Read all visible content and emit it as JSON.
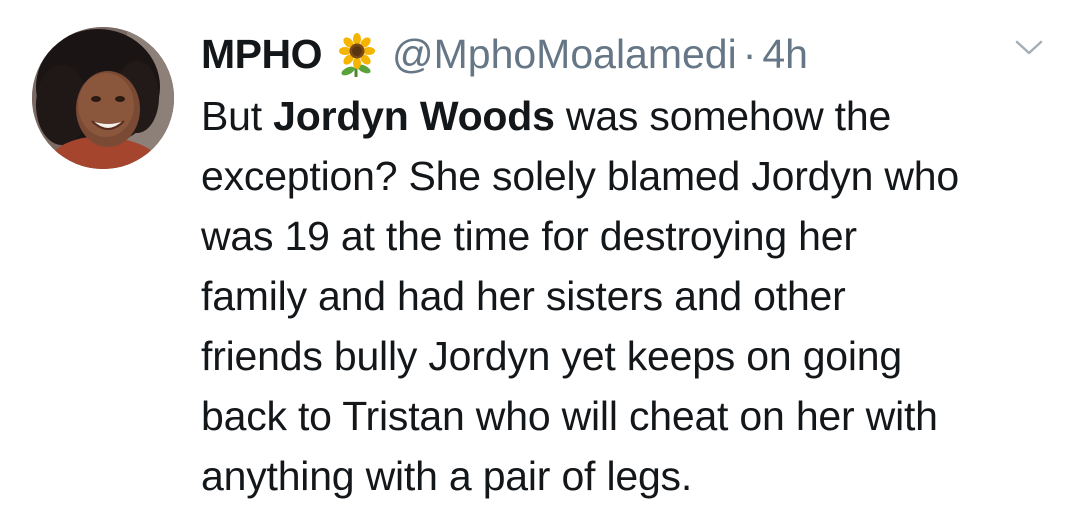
{
  "tweet": {
    "author_name": "MPHO",
    "name_emoji": "sunflower-icon",
    "handle": "@MphoMoalamedi",
    "separator": "·",
    "time": "4h",
    "menu_icon": "chevron-down-icon",
    "lines": [
      {
        "pre": "But ",
        "bold": "Jordyn Woods",
        "post": " was somehow the"
      },
      {
        "text": "exception? She solely blamed Jordyn who"
      },
      {
        "text": "was 19 at the time for destroying her"
      },
      {
        "text": "family and had her sisters and other"
      },
      {
        "text": "friends bully Jordyn yet keeps on going"
      },
      {
        "text": "back to Tristan who will cheat on her with"
      },
      {
        "text": "anything with a pair of legs."
      }
    ]
  },
  "colors": {
    "text": "#14171a",
    "secondary": "#657786",
    "background": "#ffffff"
  }
}
